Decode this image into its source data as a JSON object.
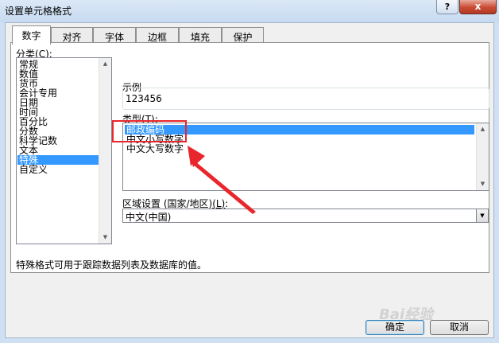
{
  "window": {
    "title": "设置单元格格式",
    "help_label": "?",
    "close_label": "x"
  },
  "tabs": [
    {
      "label": "数字",
      "active": true
    },
    {
      "label": "对齐",
      "active": false
    },
    {
      "label": "字体",
      "active": false
    },
    {
      "label": "边框",
      "active": false
    },
    {
      "label": "填充",
      "active": false
    },
    {
      "label": "保护",
      "active": false
    }
  ],
  "category": {
    "label": "分类",
    "hotkey": "(C)",
    "suffix": ":",
    "items": [
      "常规",
      "数值",
      "货币",
      "会计专用",
      "日期",
      "时间",
      "百分比",
      "分数",
      "科学记数",
      "文本",
      "特殊",
      "自定义"
    ],
    "selected": "特殊"
  },
  "sample": {
    "label": "示例",
    "value": "123456"
  },
  "type": {
    "label": "类型",
    "hotkey": "(T)",
    "suffix": ":",
    "items": [
      "邮政编码",
      "中文小写数字",
      "中文大写数字"
    ],
    "selected": "邮政编码"
  },
  "locale": {
    "label": "区域设置 (国家/地区)",
    "hotkey": "(L)",
    "suffix": ":",
    "value": "中文(中国)"
  },
  "description": "特殊格式可用于跟踪数据列表及数据库的值。",
  "buttons": {
    "ok": "确定",
    "cancel": "取消"
  },
  "watermark": "Bai经验",
  "annotation_color": "#e8262b"
}
